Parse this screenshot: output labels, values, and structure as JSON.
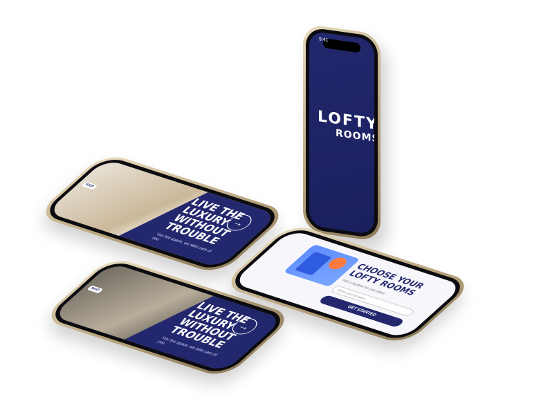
{
  "status": {
    "time": "9:41"
  },
  "splash": {
    "logo_word": "LOFTY",
    "logo_sub": "ROOMS",
    "background": "#23286e"
  },
  "hero": {
    "title_line1": "LIVE THE",
    "title_line2": "LUXURY",
    "title_line3": "WITHOUT",
    "title_line4": "TROUBLE",
    "subtitle": "You live space, we take care of you",
    "skip_label": "SKIP",
    "arrow_icon": "arrow-right-icon"
  },
  "choose": {
    "title_line1": "CHOOSE YOUR",
    "title_line2": "LOFTY ROOMS",
    "description": "Pick a location for your place",
    "search_placeholder": "Enter your location",
    "cta_label": "GET STARTED",
    "accent": "#23286e"
  }
}
